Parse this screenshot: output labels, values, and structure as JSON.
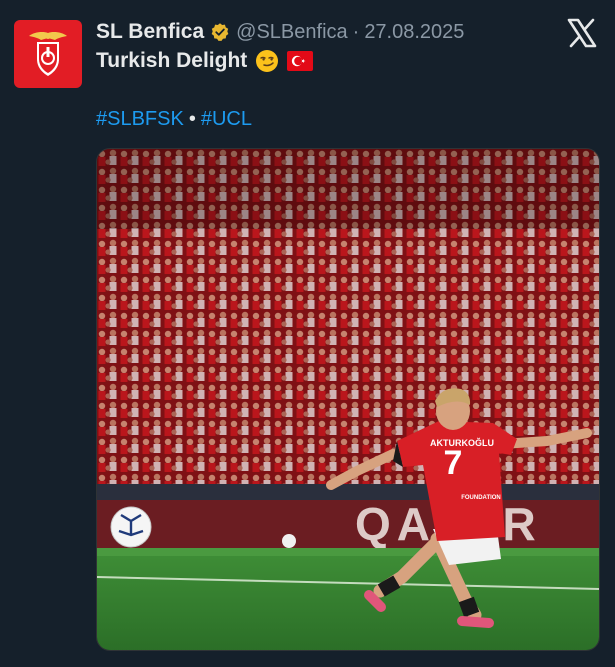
{
  "author": {
    "display_name": "SL Benfica",
    "handle": "@SLBenfica",
    "separator": "·",
    "date": "27.08.2025",
    "verified_badge_color": "#e8b730",
    "avatar_color": "#e21d25"
  },
  "tweet": {
    "text": "Turkish Delight",
    "emojis": [
      "smirking-face",
      "turkey-flag"
    ],
    "hashtags": [
      "#SLBFSK",
      "#UCL"
    ],
    "hashtag_separator": "•"
  },
  "media": {
    "player_name": "AKTURKOĞLU",
    "player_number": "7",
    "shirt_sponsor": "FOUNDATION",
    "board_text": "QATAR"
  },
  "colors": {
    "background": "#15202b",
    "text": "#e7e9ea",
    "muted": "#8b98a5",
    "link": "#1d9bf0",
    "benfica_red": "#e21d25"
  }
}
